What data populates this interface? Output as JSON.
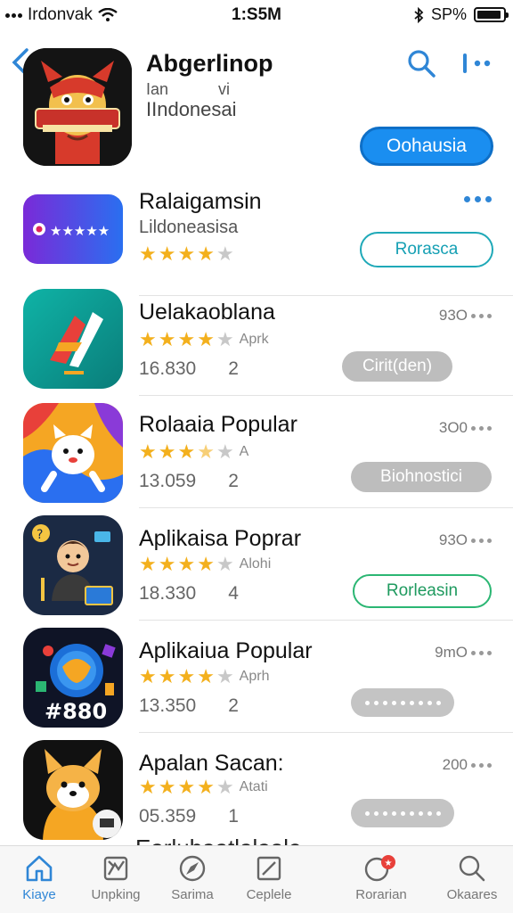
{
  "status": {
    "carrier": "Irdonvak",
    "time": "1:S5M",
    "battery": "SP%"
  },
  "header": {
    "title": "Abgerlinop",
    "sub1": "Ian",
    "sub1b": "vi",
    "sub2": "IIndonesai",
    "button": "Oohausia"
  },
  "apps": [
    {
      "name": "Ralaigamsin",
      "sub": "Lildoneasisa",
      "rating": 4,
      "button": "Rorasca",
      "button_style": "outline-teal"
    },
    {
      "name": "Uelakaoblana",
      "rating": 4,
      "rating_label": "Aprk",
      "count": "16.830",
      "rank": "2",
      "size": "93O",
      "button": "Cirit(den)",
      "button_style": "grey"
    },
    {
      "name": "Rolaaia Popular",
      "rating": 3.5,
      "rating_label": "A",
      "count": "13.059",
      "rank": "2",
      "size": "3O0",
      "button": "Biohnostici",
      "button_style": "grey"
    },
    {
      "name": "Aplikaisa Poprar",
      "rating": 4,
      "rating_label": "Alohi",
      "count": "18.330",
      "rank": "4",
      "size": "93O",
      "button": "Rorleasin",
      "button_style": "outline-green"
    },
    {
      "name": "Aplikaiua Popular",
      "rating": 4,
      "rating_label": "Aprh",
      "count": "13.350",
      "rank": "2",
      "size": "9mO",
      "button": "",
      "button_style": "dots-btn"
    },
    {
      "name": "Apalan Sacan:",
      "rating": 4,
      "rating_label": "Atati",
      "count": "05.359",
      "rank": "1",
      "size": "200",
      "button": "",
      "button_style": "dots-btn"
    }
  ],
  "partial_text": "Earlubaatlalaale",
  "tabs": [
    {
      "label": "Kiaye",
      "icon": "home-icon",
      "active": true
    },
    {
      "label": "Unpking",
      "icon": "ranking-icon",
      "active": false
    },
    {
      "label": "Sarima",
      "icon": "compass-icon",
      "active": false
    },
    {
      "label": "Ceplele",
      "icon": "edit-icon",
      "active": false
    },
    {
      "label": "Rorarian",
      "icon": "notification-icon",
      "active": false
    },
    {
      "label": "Okaares",
      "icon": "search-icon",
      "active": false
    }
  ],
  "colors": {
    "accent": "#1a8ef0",
    "star": "#f3b01d",
    "teal": "#1fa9b8",
    "green": "#2bb673"
  }
}
